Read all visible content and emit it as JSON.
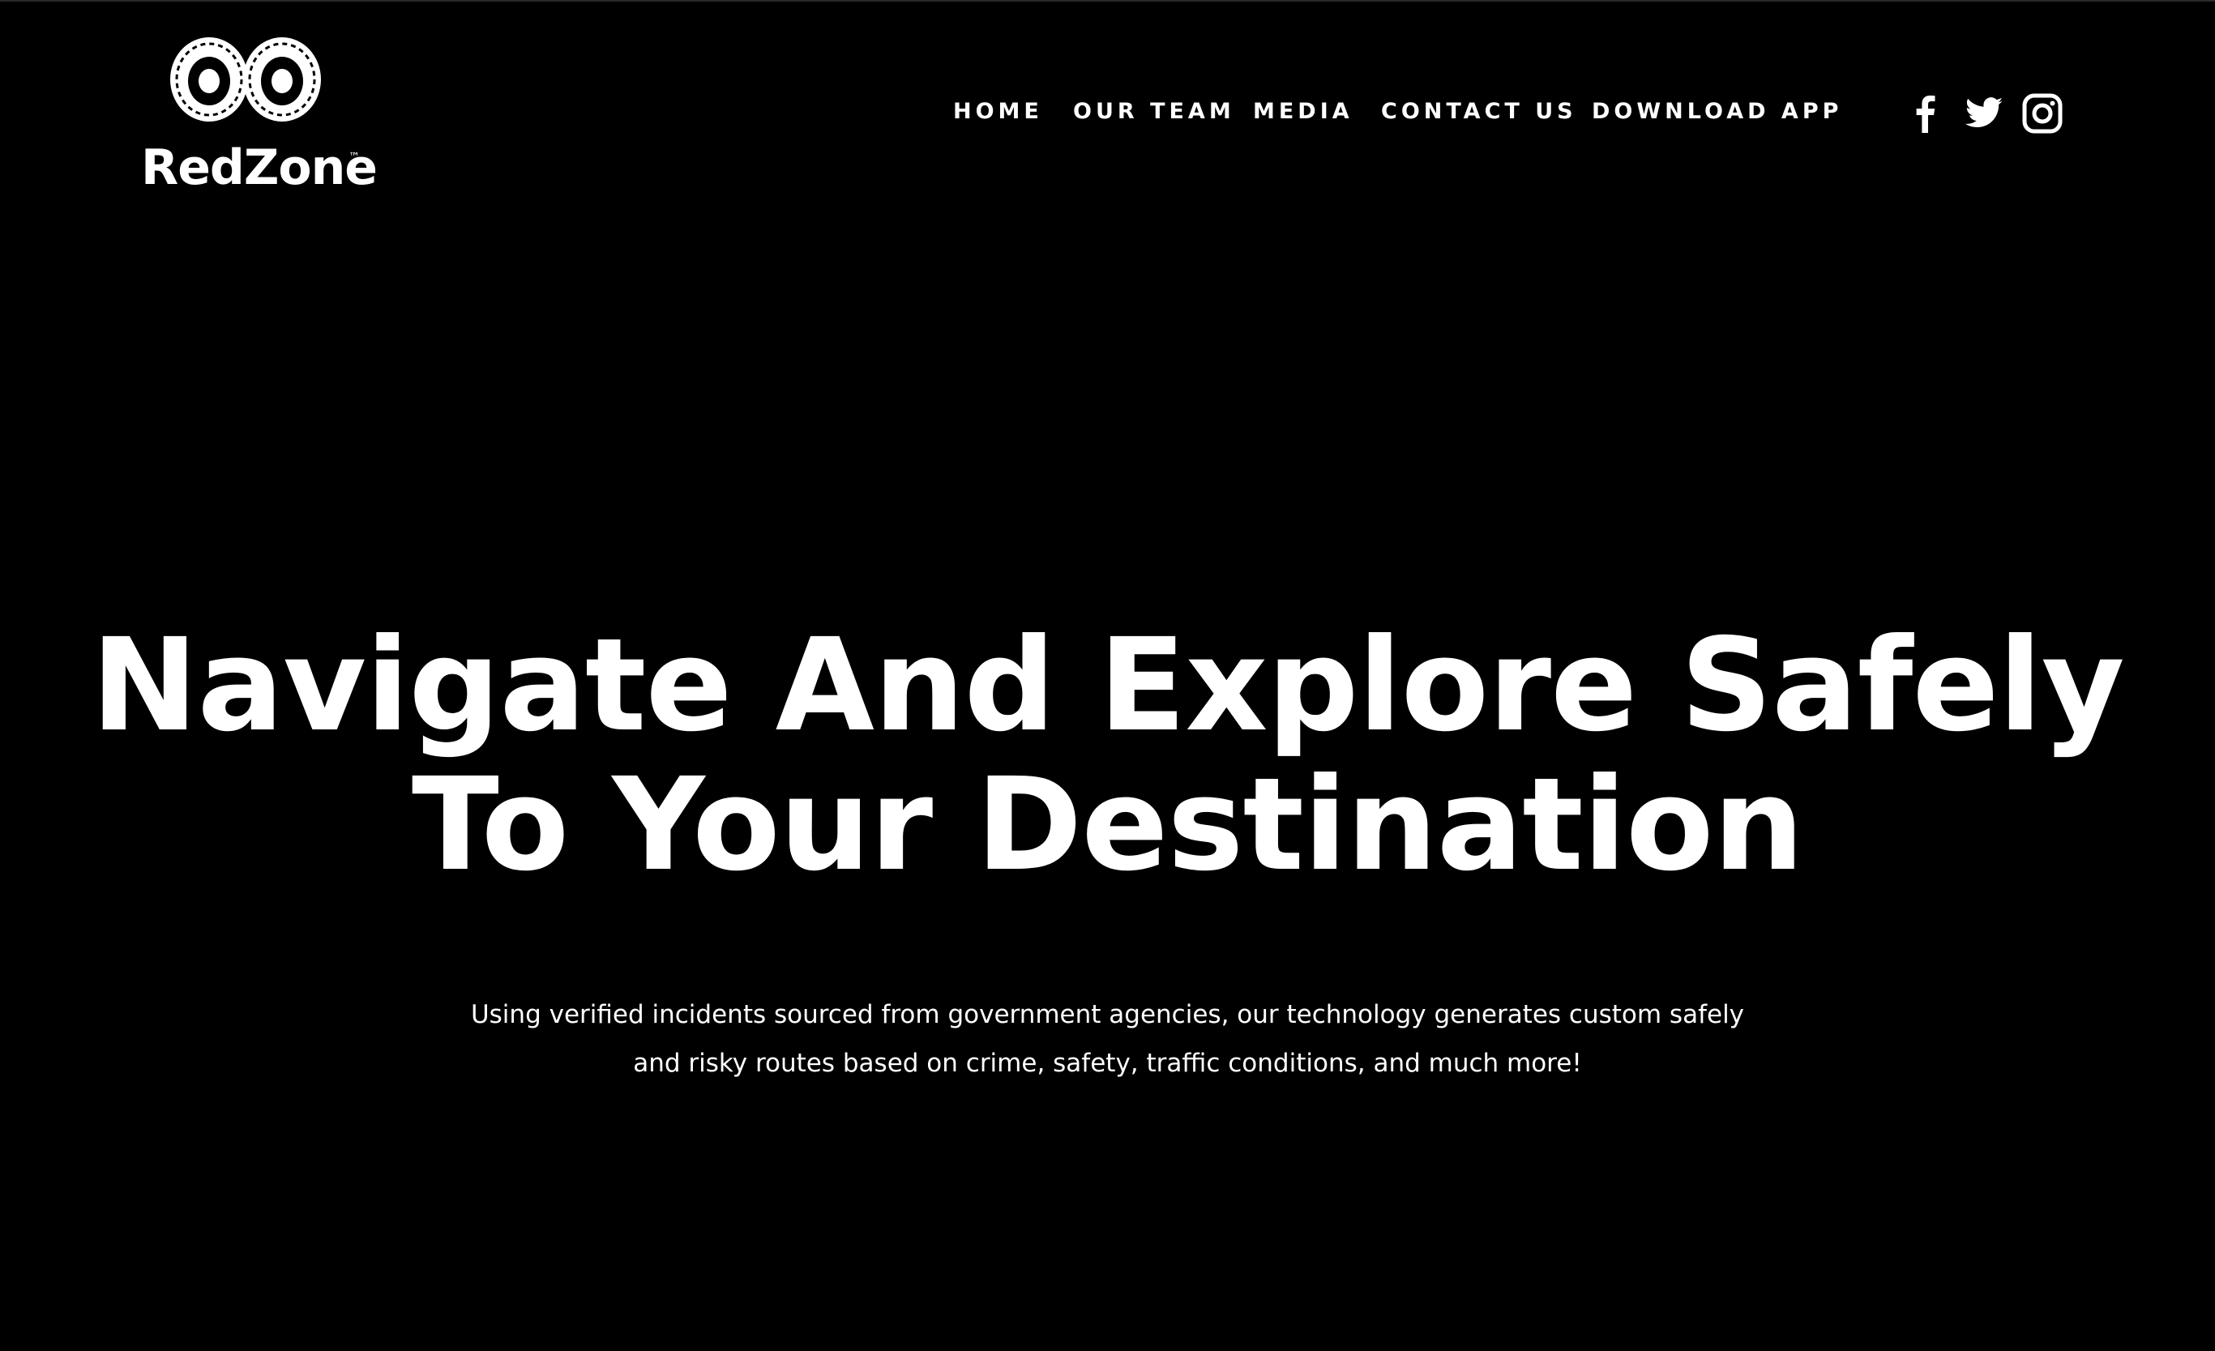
{
  "brand": {
    "name": "RedZone",
    "trademark": "™"
  },
  "nav": {
    "items": [
      {
        "label": "HOME"
      },
      {
        "label": "OUR TEAM"
      },
      {
        "label": "MEDIA"
      },
      {
        "label": "CONTACT US"
      },
      {
        "label": "DOWNLOAD APP"
      }
    ]
  },
  "social": {
    "icons": [
      "facebook-icon",
      "twitter-icon",
      "instagram-icon"
    ]
  },
  "hero": {
    "title_line1": "Navigate And Explore Safely",
    "title_line2": "To Your Destination",
    "subtitle_line1": "Using verified incidents sourced from government agencies, our technology generates custom safely",
    "subtitle_line2": "and risky routes based on crime, safety, traffic conditions, and much more!"
  },
  "colors": {
    "background": "#000000",
    "text": "#ffffff"
  }
}
